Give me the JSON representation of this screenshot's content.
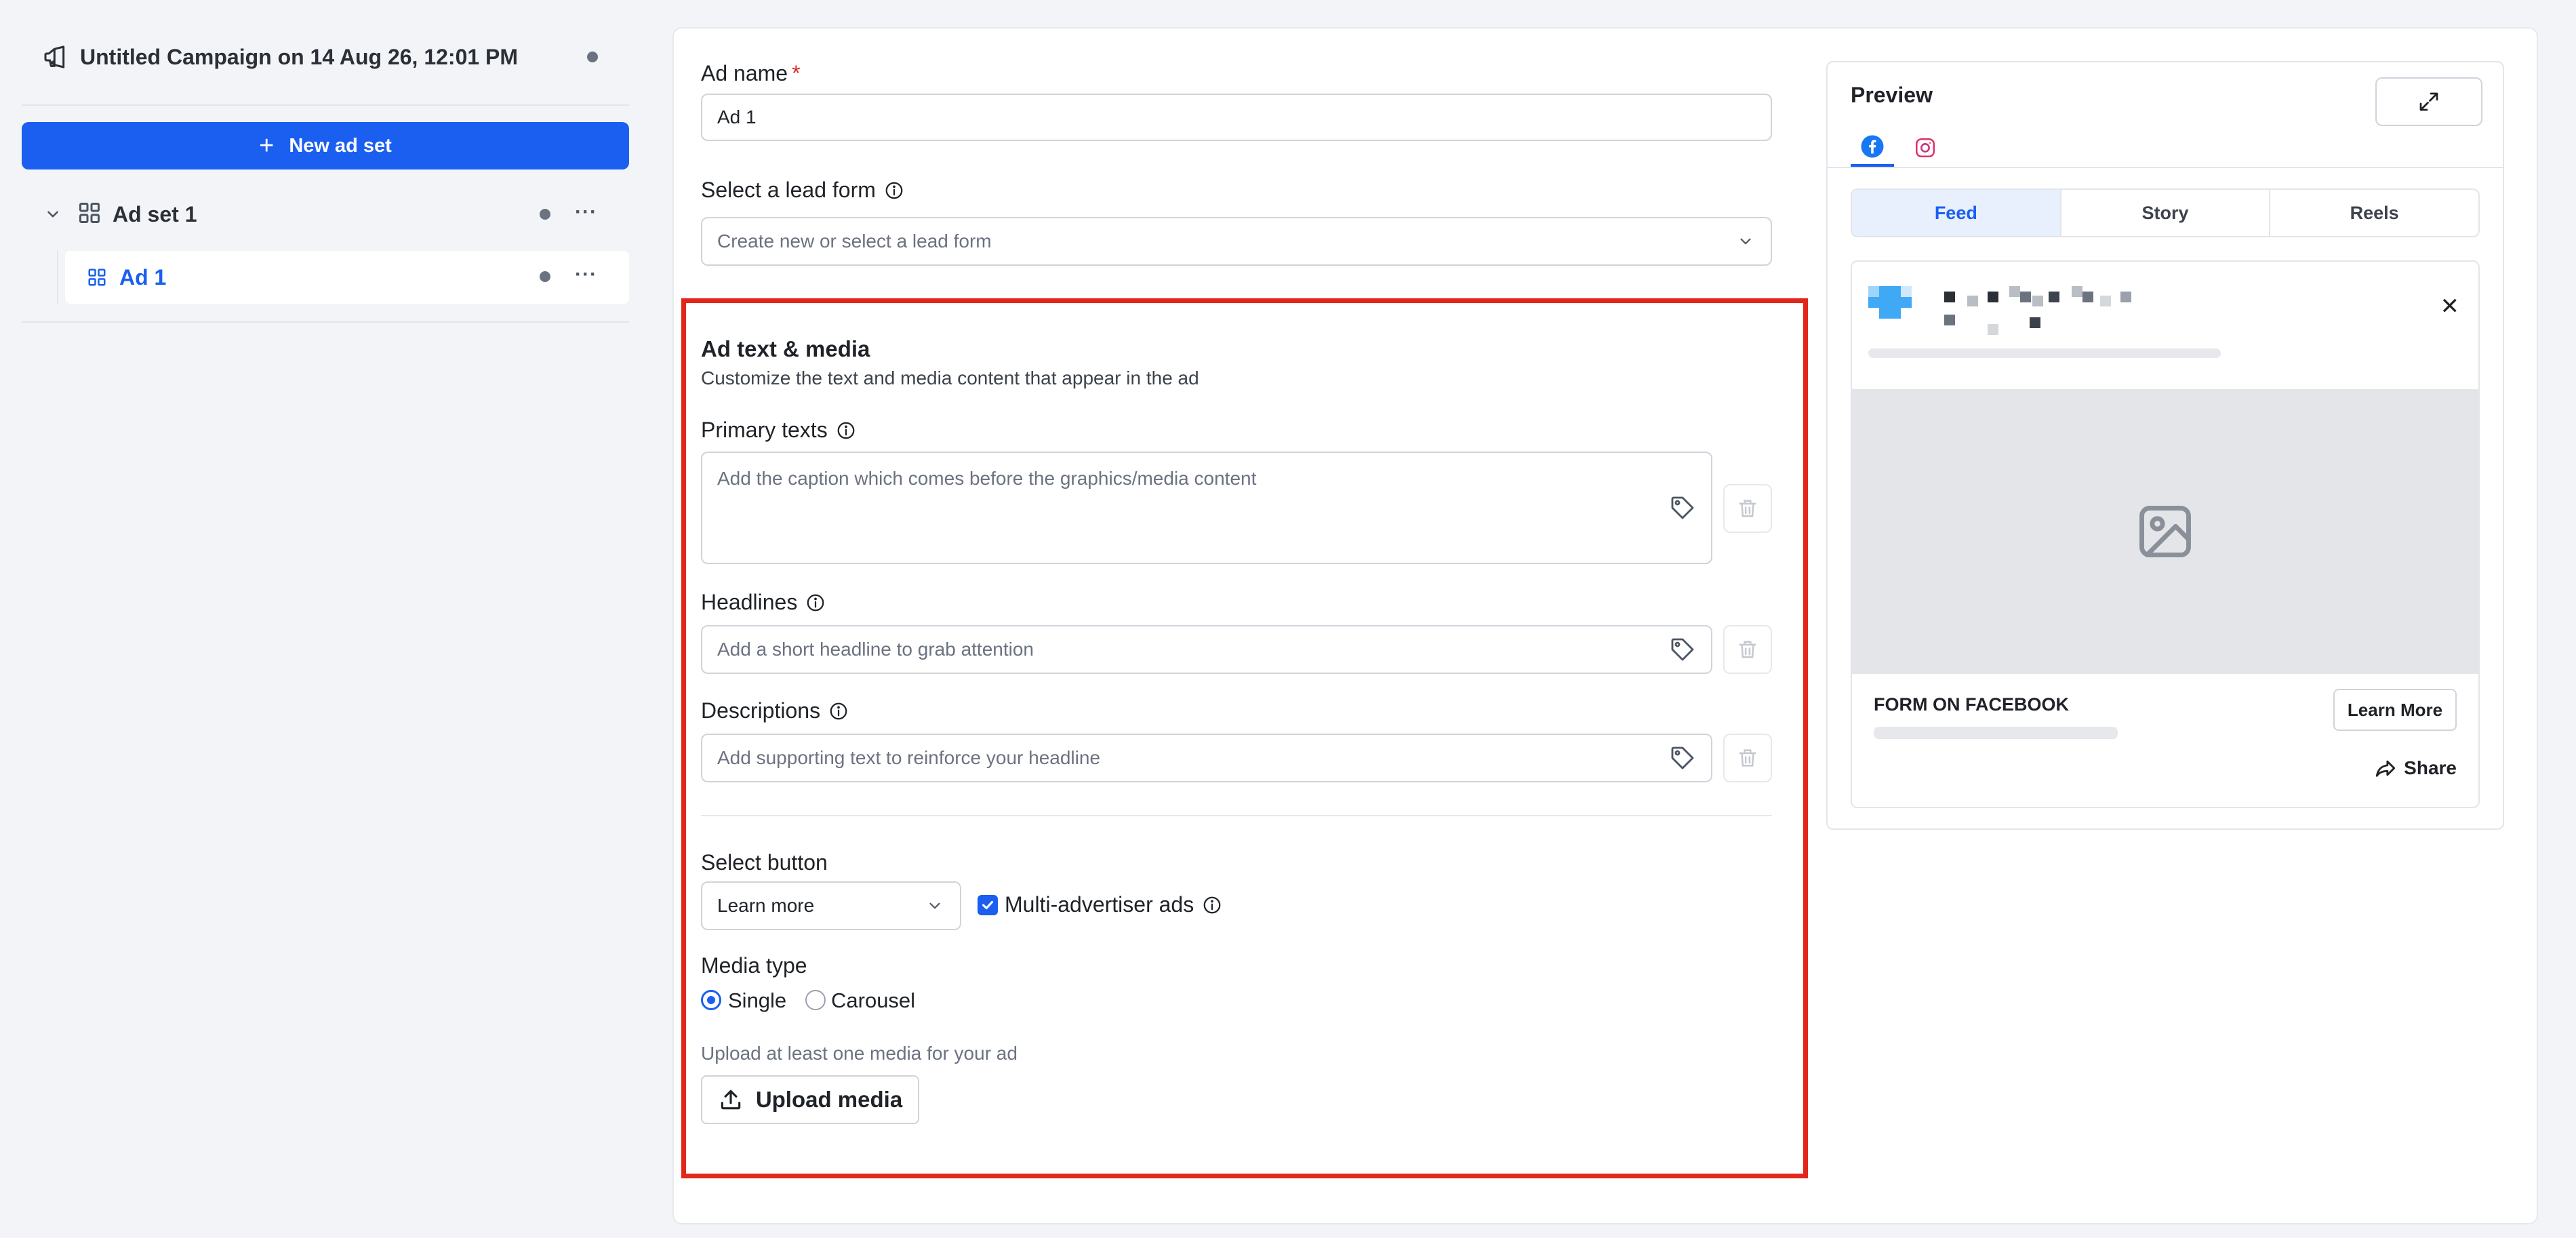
{
  "sidebar": {
    "campaign_title": "Untitled Campaign on 14 Aug 26, 12:01 PM",
    "new_adset_label": "New ad set",
    "adset_label": "Ad set 1",
    "ad_label": "Ad 1",
    "more_label": "···"
  },
  "form": {
    "ad_name_label": "Ad name",
    "required_mark": "*",
    "ad_name_value": "Ad 1",
    "lead_form_label": "Select a lead form",
    "lead_form_placeholder": "Create new or select a lead form",
    "section_title": "Ad text & media",
    "section_subtitle": "Customize the text and media content that appear in the ad",
    "primary_texts_label": "Primary texts",
    "primary_texts_placeholder": "Add the caption which comes before the graphics/media content",
    "headlines_label": "Headlines",
    "headlines_placeholder": "Add a short headline to grab attention",
    "descriptions_label": "Descriptions",
    "descriptions_placeholder": "Add supporting text to reinforce your headline",
    "select_button_label": "Select button",
    "select_button_value": "Learn more",
    "multi_advertiser_label": "Multi-advertiser ads",
    "multi_advertiser_checked": true,
    "media_type_label": "Media type",
    "media_type_options": [
      "Single",
      "Carousel"
    ],
    "media_type_selected": "Single",
    "upload_hint": "Upload at least one media for your ad",
    "upload_button_label": "Upload media"
  },
  "preview": {
    "title": "Preview",
    "networks": [
      "facebook",
      "instagram"
    ],
    "active_network": "facebook",
    "placements": [
      "Feed",
      "Story",
      "Reels"
    ],
    "active_placement": "Feed",
    "close_glyph": "✕",
    "form_title": "FORM ON FACEBOOK",
    "cta_label": "Learn More",
    "share_label": "Share"
  },
  "colors": {
    "accent": "#1a5ff0",
    "highlight_border": "#e3261a",
    "background": "#f3f4f7"
  }
}
